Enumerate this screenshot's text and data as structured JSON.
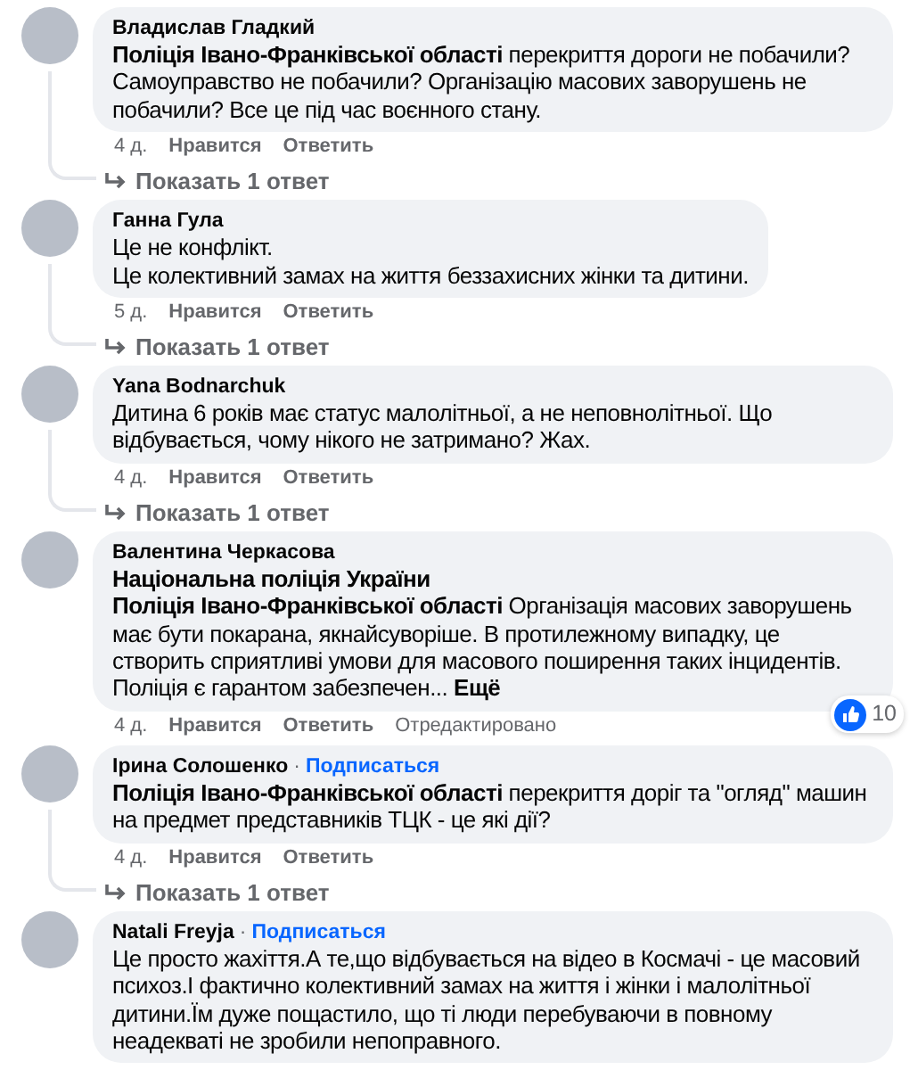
{
  "comments": [
    {
      "author": "Владислав Гладкий",
      "lines": [
        "**Поліція Івано-Франківської області** перекриття дороги не побачили? Самоуправство не побачили? Організацію масових заворушень не побачили? Все це під час воєнного стану."
      ],
      "time": "4 д.",
      "like": "Нравится",
      "reply": "Ответить",
      "replies_link": "Показать 1 ответ"
    },
    {
      "author": "Ганна Гула",
      "lines": [
        "Це не конфлікт.",
        "Це колективний замах на життя беззахисних жінки та дитини."
      ],
      "time": "5 д.",
      "like": "Нравится",
      "reply": "Ответить",
      "replies_link": "Показать 1 ответ"
    },
    {
      "author": "Yana Bodnarchuk",
      "lines": [
        "Дитина 6 років має статус малолітньої, а не неповнолітньої. Що відбувається, чому нікого не затримано? Жах."
      ],
      "time": "4 д.",
      "like": "Нравится",
      "reply": "Ответить",
      "replies_link": "Показать 1 ответ"
    },
    {
      "author": "Валентина Черкасова",
      "lines": [
        "**Національна поліція України**",
        "**Поліція Івано-Франківської області** Організація масових заворушень має бути покарана, якнайсуворіше. В протилежному випадку, це створить сприятливі умови для масового поширення таких інцидентів. Поліція є гарантом забезпечен... **Ещё**"
      ],
      "time": "4 д.",
      "like": "Нравится",
      "reply": "Ответить",
      "edited": "Отредактировано",
      "reaction_count": "10"
    },
    {
      "author": "Ірина Солошенко",
      "separator": "·",
      "follow": "Подписаться",
      "lines": [
        "**Поліція Івано-Франківської області** перекриття доріг та \"огляд\" машин на предмет представників ТЦК - це які дії?"
      ],
      "time": "4 д.",
      "like": "Нравится",
      "reply": "Ответить",
      "replies_link": "Показать 1 ответ"
    },
    {
      "author": "Natali Freyja",
      "separator": "·",
      "follow": "Подписаться",
      "lines": [
        "Це просто жахіття.А те,що відбувається на відео в Космачі - це масовий психоз.І фактично колективний замах на життя і жінки і малолітньої дитини.Їм дуже пощастило, що ті люди перебуваючи в повному неадекваті не зробили непоправного."
      ]
    }
  ]
}
